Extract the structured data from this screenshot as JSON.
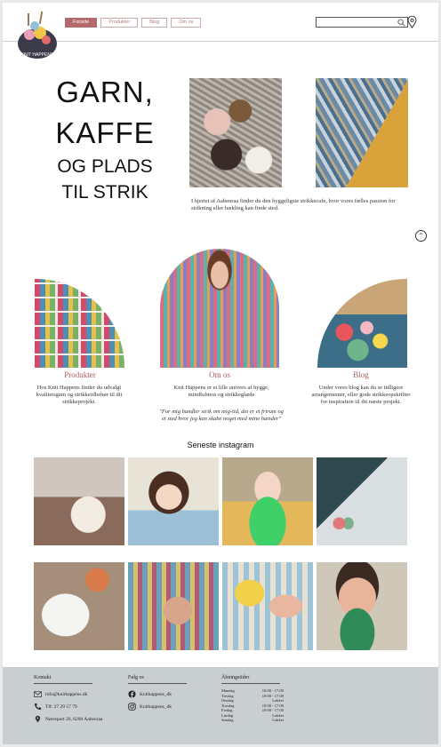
{
  "header": {
    "logo_text": "KNIT HAPPENS",
    "nav": [
      "Forside",
      "Produkter",
      "Blog",
      "Om os"
    ],
    "search": {
      "value": "",
      "placeholder": ""
    }
  },
  "hero": {
    "title_line1": "GARN,",
    "title_line2": "KAFFE",
    "title_line3": "OG PLADS",
    "title_line4": "TIL STRIK",
    "description": "I hjertet af Aabenraa finder du den hyggeligste strikkecafe, hvor vores fælles passion for strikning eller hækling kan finde sted."
  },
  "cards": {
    "left": {
      "title": "Produkter",
      "text": "Hos Knit Happens finder du udvalgt kvalitetsgarn og strikketilbehør til dit strikkeprojekt."
    },
    "middle": {
      "title": "Om os",
      "text": "Knit Happens er et lille univers af hygge, mindfulness og strikkeglæde",
      "quote": "\"For mig handler strik om mig-tid, det er et frirum og et sted hvor jeg kan skabe noget med mine hænder\""
    },
    "right": {
      "title": "Blog",
      "text": "Under vores blog kan du se tidligere arrangementer, eller gode strikkeopskrifter for inspiration til dit næste projekt."
    }
  },
  "instagram": {
    "title": "Seneste instagram"
  },
  "footer": {
    "contact": {
      "heading": "Kontakt",
      "email": "info@knithappens.dk",
      "phone": "Tlf: 27 29 57 79",
      "address": "Nørreport 20, 6200 Aabenraa"
    },
    "follow": {
      "heading": "Følg os",
      "facebook": "Knithappens_dk",
      "instagram": "Knithappens_dk"
    },
    "hours": {
      "heading": "Åbningstider",
      "rows": [
        {
          "day": "Mandag",
          "time": "10:00 - 17:00"
        },
        {
          "day": "Tirsdag",
          "time": "10:00 - 17:00"
        },
        {
          "day": "Onsdag",
          "time": "Lukket"
        },
        {
          "day": "Torsdag",
          "time": "10:00 - 17:00"
        },
        {
          "day": "Fredag",
          "time": "10:00 - 17:00"
        },
        {
          "day": "Lørdag",
          "time": "Lukket"
        },
        {
          "day": "Søndag",
          "time": "Lukket"
        }
      ]
    }
  },
  "colors": {
    "accent": "#b46a6a",
    "footer_bg": "#c9cfd0"
  }
}
